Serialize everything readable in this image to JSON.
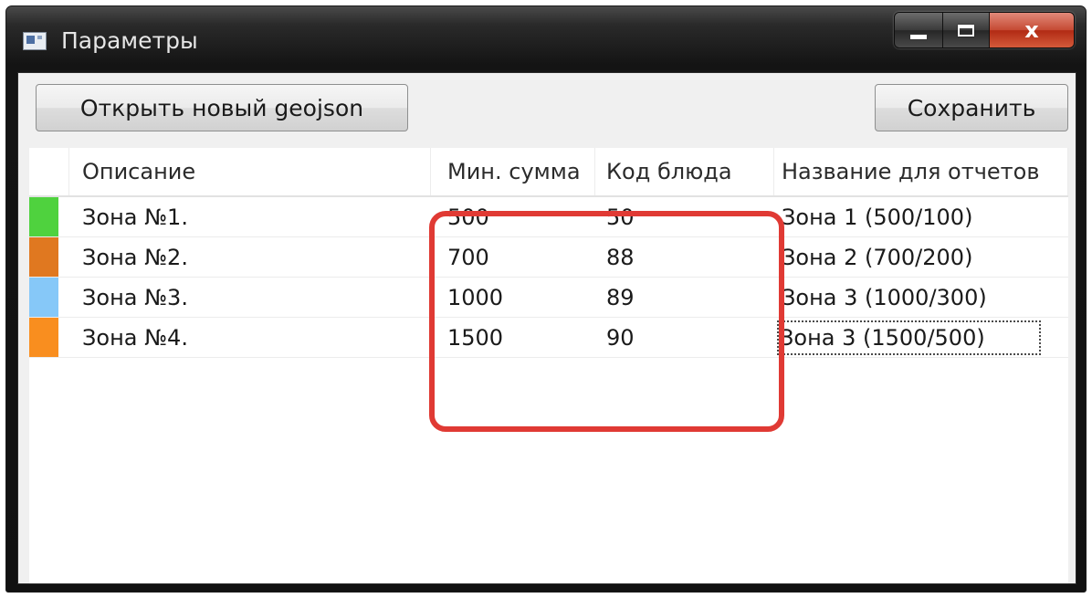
{
  "window": {
    "title": "Параметры"
  },
  "caption_buttons": {
    "close_glyph": "x"
  },
  "toolbar": {
    "open_label": "Открыть новый geojson",
    "save_label": "Сохранить"
  },
  "table": {
    "columns": [
      "",
      "Описание",
      "Мин. сумма",
      "Код блюда",
      "Название для отчетов"
    ],
    "rows": [
      {
        "color": "#4fd23e",
        "description": "Зона №1.",
        "min_sum": "500",
        "dish_code": "50",
        "report_name": "Зона 1 (500/100)"
      },
      {
        "color": "#e07820",
        "description": "Зона №2.",
        "min_sum": "700",
        "dish_code": "88",
        "report_name": "Зона 2 (700/200)"
      },
      {
        "color": "#86c8f8",
        "description": "Зона №3.",
        "min_sum": "1000",
        "dish_code": "89",
        "report_name": "Зона 3 (1000/300)"
      },
      {
        "color": "#f98e1f",
        "description": "Зона №4.",
        "min_sum": "1500",
        "dish_code": "90",
        "report_name": "Зона 3 (1500/500)"
      }
    ]
  },
  "annotation": {
    "highlight_color": "#e03a34"
  }
}
